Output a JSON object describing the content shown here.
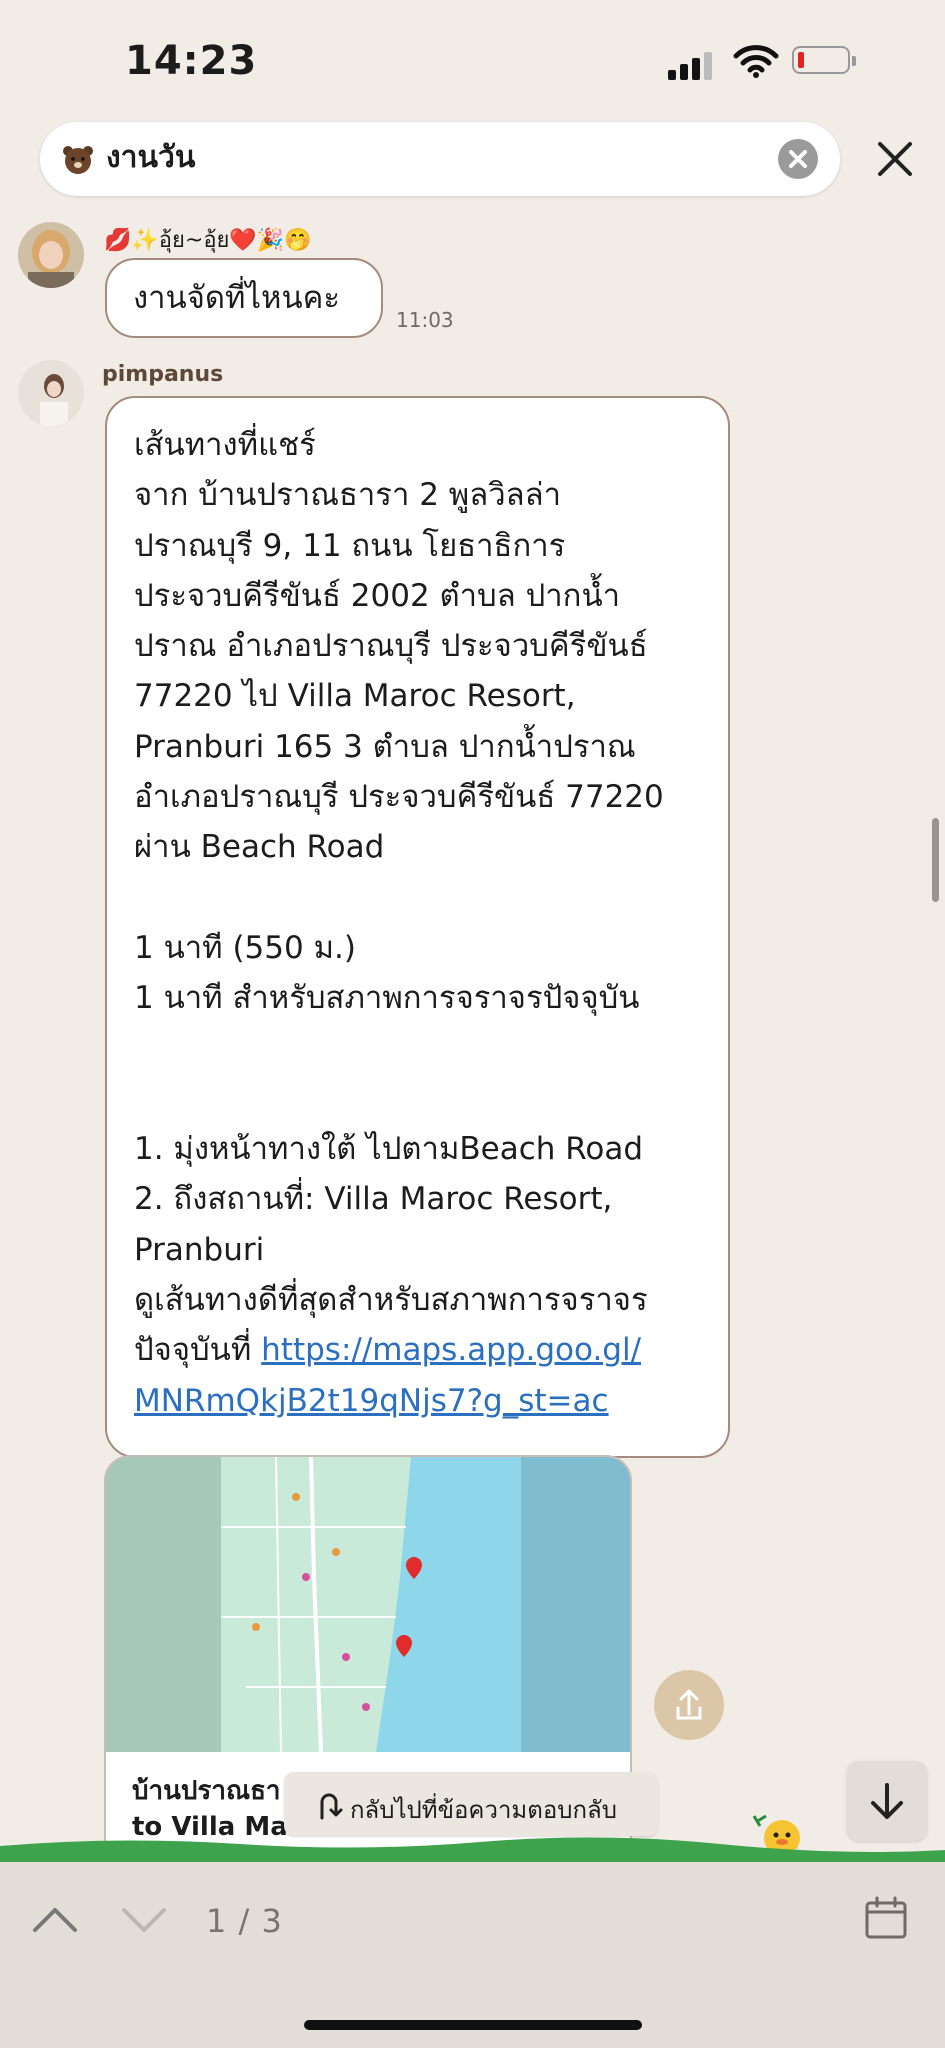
{
  "status": {
    "time": "14:23"
  },
  "search": {
    "query": "งานวัน"
  },
  "messages": [
    {
      "sender": "💋✨อุ้ย~อุ้ย❤️🎉🤭",
      "text": "งานจัดที่ไหนคะ",
      "time": "11:03"
    },
    {
      "sender": "pimpanus",
      "text": "เส้นทางที่แชร์\nจาก บ้านปราณธารา 2 พูลวิลล่า\nปราณบุรี 9, 11 ถนน โยธาธิการ\nประจวบคีรีขันธ์ 2002 ตำบล ปากน้ำ\nปราณ อำเภอปราณบุรี ประจวบคีรีขันธ์\n77220 ไป Villa Maroc Resort,\nPranburi 165 3 ตำบล ปากน้ำปราณ\nอำเภอปราณบุรี ประจวบคีรีขันธ์ 77220\nผ่าน Beach Road\n\n1 นาที (550 ม.)\n1 นาที สำหรับสภาพการจราจรปัจจุบัน\n\n\n1. มุ่งหน้าทางใต้ ไปตามBeach Road\n2. ถึงสถานที่: Villa Maroc Resort,\nPranburi\nดูเส้นทางดีที่สุดสำหรับสภาพการจราจร\nปัจจุบันที่ ",
      "link": "https://maps.app.goo.gl/\nMNRmQkjB2t19qNjs7?g_st=ac"
    }
  ],
  "map_card": {
    "title": "บ้านปราณธา\nto Villa Ma"
  },
  "reply_jump": {
    "label": "กลับไปที่ข้อความตอบกลับ"
  },
  "search_nav": {
    "counter": "1 / 3"
  }
}
